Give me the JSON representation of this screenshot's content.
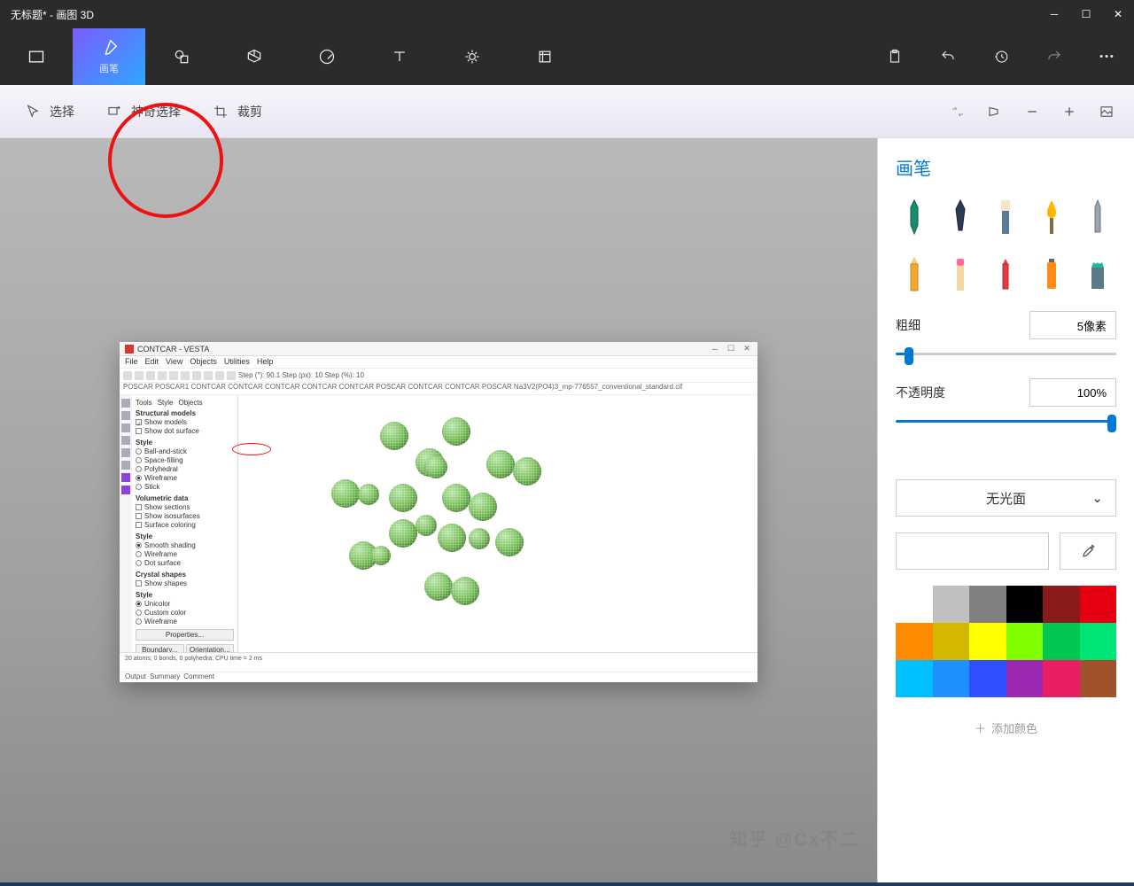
{
  "window": {
    "title": "无标题* - 画图 3D"
  },
  "toolbar": {
    "brush": "画笔"
  },
  "subbar": {
    "select": "选择",
    "magic": "神奇选择",
    "crop": "裁剪"
  },
  "panel": {
    "title": "画笔",
    "thickness_label": "粗细",
    "thickness_value": "5像素",
    "opacity_label": "不透明度",
    "opacity_value": "100%",
    "surface": "无光面",
    "add_color": "添加颜色"
  },
  "swatches": [
    "#ffffff",
    "#c0c0c0",
    "#808080",
    "#000000",
    "#8b1a1a",
    "#e60012",
    "#ff8c00",
    "#d4b800",
    "#ffff00",
    "#7fff00",
    "#00c853",
    "#00e676",
    "#00bfff",
    "#1e90ff",
    "#304ffe",
    "#9c27b0",
    "#e91e63",
    "#a0522d"
  ],
  "vesta": {
    "title": "CONTCAR - VESTA",
    "menus": [
      "File",
      "Edit",
      "View",
      "Objects",
      "Utilities",
      "Help"
    ],
    "toolbar_text": "Step (°): 90.1   Step (px): 10   Step (%): 10",
    "tabs": "POSCAR  POSCAR1  CONTCAR  CONTCAR  CONTCAR  CONTCAR  CONTCAR  POSCAR  CONTCAR  CONTCAR  POSCAR  Na3V2(PO4)3_mp-776557_conventional_standard.cif",
    "paneltabs": [
      "Tools",
      "Style",
      "Objects"
    ],
    "structural": "Structural models",
    "show_models": "Show models",
    "show_dot": "Show dot surface",
    "style": "Style",
    "ball": "Ball-and-stick",
    "space": "Space-filling",
    "poly": "Polyhedral",
    "wire": "Wireframe",
    "stick": "Stick",
    "voldata": "Volumetric data",
    "sections": "Show sections",
    "iso": "Show isosurfaces",
    "surfcol": "Surface coloring",
    "smooth": "Smooth shading",
    "wire2": "Wireframe",
    "dot": "Dot surface",
    "crystal": "Crystal shapes",
    "showshapes": "Show shapes",
    "unicolor": "Unicolor",
    "custom": "Custom color",
    "wire3": "Wireframe",
    "props": "Properties...",
    "boundary": "Boundary...",
    "orient": "Orientation...",
    "log1": "20 atoms, 0 bonds, 0 polyhedra; CPU time = 2 ms",
    "bottabs": [
      "Output",
      "Summary",
      "Comment"
    ]
  },
  "watermark": "知乎 @Cx不二"
}
